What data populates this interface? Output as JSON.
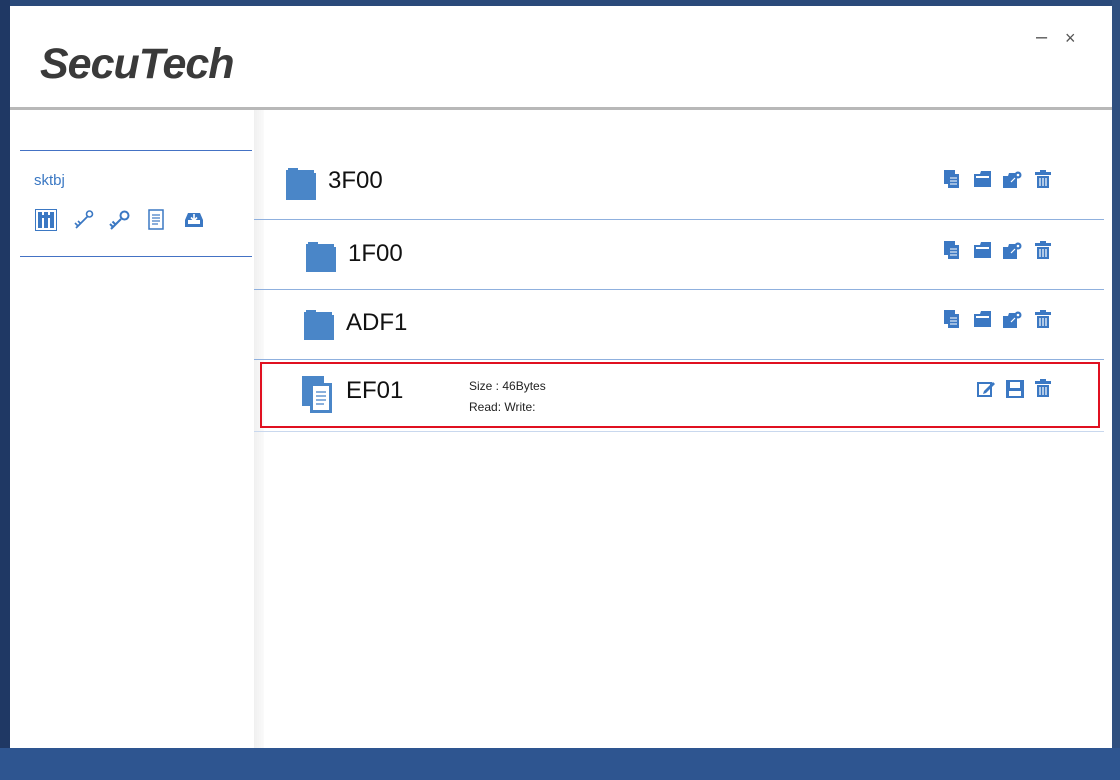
{
  "app": {
    "logo_text": "SecuTech",
    "minimize_glyph": "–",
    "close_glyph": "×"
  },
  "sidebar": {
    "device_name": "sktbj",
    "tools": [
      {
        "icon": "file-system-icon",
        "active": true
      },
      {
        "icon": "key-icon"
      },
      {
        "icon": "keys-icon"
      },
      {
        "icon": "document-icon"
      },
      {
        "icon": "download-tray-icon"
      }
    ]
  },
  "tree": {
    "items": [
      {
        "type": "folder",
        "name": "3F00",
        "actions": [
          "new-file-icon",
          "new-folder-icon",
          "key-folder-icon",
          "delete-icon"
        ]
      },
      {
        "type": "folder",
        "name": "1F00",
        "actions": [
          "new-file-icon",
          "new-folder-icon",
          "key-folder-icon",
          "delete-icon"
        ]
      },
      {
        "type": "folder",
        "name": "ADF1",
        "actions": [
          "new-file-icon",
          "new-folder-icon",
          "key-folder-icon",
          "delete-icon"
        ]
      },
      {
        "type": "file",
        "name": "EF01",
        "size_label": "Size : 46Bytes",
        "access_label": "Read:  Write:",
        "selected": true,
        "actions": [
          "edit-icon",
          "save-icon",
          "delete-icon"
        ]
      }
    ]
  },
  "colors": {
    "accent": "#3b78c3",
    "selection": "#e01020",
    "frame": "#2e5590"
  }
}
